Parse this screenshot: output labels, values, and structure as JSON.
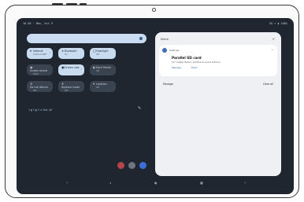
{
  "status_bar": {
    "time": "10:30 · Mon, Oct 9",
    "right": "5G ▾ ▮ 100%"
  },
  "tiles": [
    {
      "label": "Internet",
      "sub": "Android Wifi",
      "icon": "▾",
      "state": "on",
      "chev": "›"
    },
    {
      "label": "Bluetooth",
      "sub": "On",
      "icon": "∗",
      "state": "on",
      "chev": ""
    },
    {
      "label": "Flashlight",
      "sub": "Off",
      "icon": "□",
      "state": "on",
      "chev": ""
    },
    {
      "label": "Screen record",
      "sub": "Start",
      "icon": "◉",
      "state": "off",
      "chev": ""
    },
    {
      "label": "Screen cast",
      "sub": "",
      "icon": "▣",
      "state": "on",
      "chev": "›"
    },
    {
      "label": "Dark theme",
      "sub": "Off",
      "icon": "◐",
      "state": "off",
      "chev": ""
    },
    {
      "label": "Do not disturb",
      "sub": "Off",
      "icon": "⊖",
      "state": "off",
      "chev": ""
    },
    {
      "label": "Airplane mode",
      "sub": "Off",
      "icon": "✈",
      "state": "off",
      "chev": ""
    },
    {
      "label": "Location",
      "sub": "Off",
      "icon": "⌖",
      "state": "off",
      "chev": ""
    }
  ],
  "footer": {
    "text": "1 ▮ 2 ▮ 3  ≫  Not  ⌫",
    "edit_icon": "✎"
  },
  "notifications": {
    "header": "Silent",
    "close": "×",
    "card": {
      "app": "Settings",
      "expand": "⌄",
      "title": "Parallel SD card",
      "text": "For media items / photos & some actions",
      "actions": [
        "Manage",
        "Eject"
      ]
    },
    "manage": "Manage",
    "clear": "Clear all"
  },
  "nav": {
    "back": "◂",
    "home": "●",
    "recents": "■"
  },
  "colors": {
    "screen": "#1f2630",
    "accent": "#c8dbef",
    "panel": "#eef0f3"
  }
}
